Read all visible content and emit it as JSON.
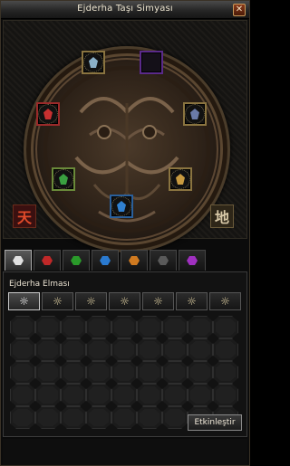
{
  "window": {
    "title": "Ejderha Taşı Simyası",
    "close_glyph": "✕"
  },
  "altar": {
    "slots": [
      {
        "name": "slot-top-left",
        "kind": "gold",
        "gem_color": "#8ab0c8"
      },
      {
        "name": "slot-top-right",
        "kind": "purple",
        "gem_color": ""
      },
      {
        "name": "slot-left",
        "kind": "red",
        "gem_color": "#c83030"
      },
      {
        "name": "slot-right",
        "kind": "gold",
        "gem_color": "#6a7aa8"
      },
      {
        "name": "slot-bottom-left",
        "kind": "green",
        "gem_color": "#3aa040"
      },
      {
        "name": "slot-bottom-right",
        "kind": "gold",
        "gem_color": "#c89a40"
      },
      {
        "name": "slot-bottom",
        "kind": "blue",
        "gem_color": "#3080d0"
      }
    ],
    "rune_heaven": "天",
    "rune_earth": "地"
  },
  "tabs": [
    {
      "name": "tab-all",
      "gem_color": "#e0e0e0",
      "active": true
    },
    {
      "name": "tab-red",
      "gem_color": "#c02828",
      "active": false
    },
    {
      "name": "tab-green",
      "gem_color": "#2a9a2a",
      "active": false
    },
    {
      "name": "tab-blue",
      "gem_color": "#2a7ad0",
      "active": false
    },
    {
      "name": "tab-orange",
      "gem_color": "#d07a20",
      "active": false
    },
    {
      "name": "tab-black",
      "gem_color": "#5a5a5a",
      "active": false
    },
    {
      "name": "tab-purple",
      "gem_color": "#a030c0",
      "active": false
    }
  ],
  "inventory": {
    "section_label": "Ejderha Elması",
    "types": [
      "☼",
      "☼",
      "☼",
      "☼",
      "☼",
      "☼",
      "☼"
    ],
    "grid_rows": 5,
    "grid_cols": 9
  },
  "actions": {
    "activate_label": "Etkinleştir"
  }
}
